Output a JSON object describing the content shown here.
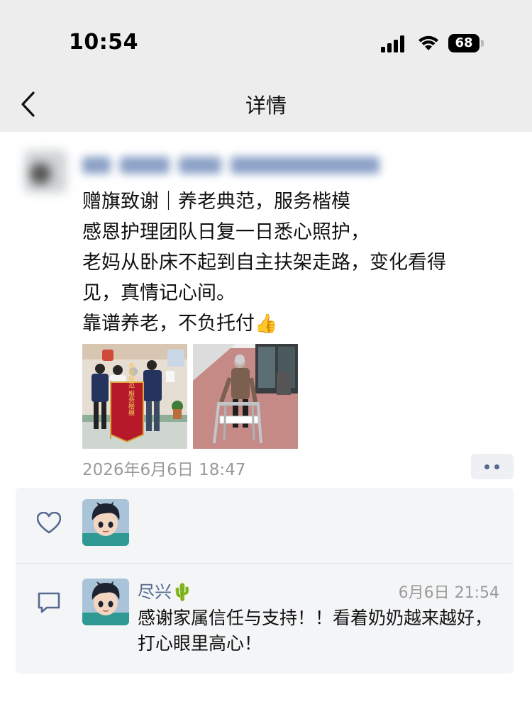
{
  "status_bar": {
    "time": "10:54",
    "battery": "68"
  },
  "nav": {
    "title": "详情"
  },
  "post": {
    "lines": [
      "赠旗致谢｜养老典范，服务楷模",
      "感恩护理团队日复一日悉心照护，",
      "老妈从卧床不起到自主扶架走路，变化看得",
      "见，真情记心间。",
      "靠谱养老，不负托付"
    ],
    "emoji": "👍",
    "banner_text": "养老典范 服务楷模",
    "timestamp": "2026年6月6日 18:47"
  },
  "comment": {
    "author": "尽兴",
    "author_emoji": "🌵",
    "time": "6月6日 21:54",
    "text": "感谢家属信任与支持！！看着奶奶越来越好，打心眼里高心！"
  },
  "icons": {
    "back": "chevron-left-icon",
    "like": "heart-icon",
    "comment": "comment-icon",
    "more": "more-dots-icon"
  },
  "colors": {
    "link_blue": "#566a8f",
    "header_bg": "#ededed",
    "panel_bg": "#f4f5f7"
  }
}
